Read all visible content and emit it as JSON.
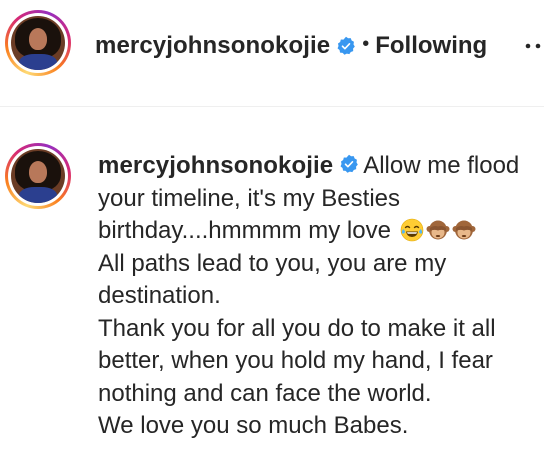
{
  "post_header": {
    "username": "mercyjohnsonokojie",
    "separator": "•",
    "follow_status": "Following"
  },
  "caption": {
    "username": "mercyjohnsonokojie",
    "lines": [
      "Allow me flood",
      "your timeline, it's my Besties",
      "birthday....hmmmm my love",
      "All paths lead to you, you are my",
      "destination.",
      "Thank you for all you do to make it all",
      "better, when you hold my hand, I fear",
      "nothing and can face the world.",
      "We love you so much Babes."
    ],
    "emojis": [
      "face-with-tears-of-joy-emoji",
      "see-no-evil-monkey-emoji",
      "see-no-evil-monkey-emoji"
    ]
  },
  "icons": {
    "verified": "verified-badge-icon",
    "more": "more-options-icon"
  },
  "colors": {
    "text": "#262626",
    "verified_blue": "#3897f0",
    "divider": "#efefef"
  }
}
